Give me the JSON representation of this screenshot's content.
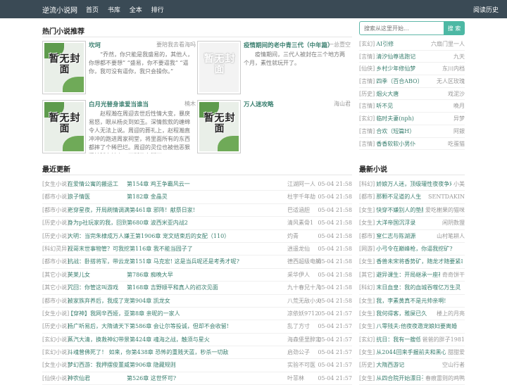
{
  "nav": {
    "brand": "逆流小说网",
    "links": [
      "首页",
      "书库",
      "全本",
      "排行"
    ],
    "history": "阅读历史"
  },
  "search": {
    "placeholder": "搜索从这里开始...",
    "button": "搜 索"
  },
  "hot": {
    "title": "热门小说推荐",
    "cover_text": "暂无封面",
    "items": [
      {
        "title": "坎坷",
        "author": "要陪我去看海吗",
        "desc": "“乔然，你只能是我盛易的，其他人，你想都不要想”  “盛易，你不要逼我” “逼你，我可没有逼你，我只会操你。”",
        "blank": false
      },
      {
        "title": "疫情期间的老中青三代（中年篇）",
        "author": "一总壹空",
        "desc": "疫情期间，三代人被封在三个地方两个月，素性就玩开了。",
        "blank": true
      },
      {
        "title": "白月光替身谁爱当谁当",
        "author": "楠木",
        "desc": "赵程瀚在周迎去世后性情大变，暴戾易怒，眼从杨炎到如玉。深情款款的缠绵令人无法上说。周迎的葬礼上，赵程瀚直冲冲的跑进周家祠堂，将里面所有的东西都摔了个稀巴烂。周迎的灵位也被他恶狠狠地踩在地上，不断的在脚下",
        "blank": false
      },
      {
        "title": "万人迷攻略",
        "author": "海山君",
        "desc": "",
        "blank": false
      }
    ]
  },
  "rank": [
    {
      "cat": "[玄幻]",
      "title": "AI引修",
      "author": "六扇门里一人"
    },
    {
      "cat": "[言情]",
      "title": "清汐仙尊逃跑记",
      "author": "九天"
    },
    {
      "cat": "[仙侠]",
      "title": "乡村少年修仙梦",
      "author": "东川内档"
    },
    {
      "cat": "[言情]",
      "title": "四季（百合ABO）",
      "author": "无人区玫瑰"
    },
    {
      "cat": "[历史]",
      "title": "烟火大唐",
      "author": "戏泥沙"
    },
    {
      "cat": "[言情]",
      "title": "听不见",
      "author": "晚月"
    },
    {
      "cat": "[玄幻]",
      "title": "临时夫妻(nph)",
      "author": "异梦"
    },
    {
      "cat": "[言情]",
      "title": "合欢（短篇H）",
      "author": "阿銀"
    },
    {
      "cat": "[言情]",
      "title": "香香软软小男仆",
      "author": "吃蛋猫"
    }
  ],
  "latest": {
    "title": "最近更新",
    "rows": [
      {
        "cat": "[女生小说]",
        "title": "在爱情公寓的搬运工",
        "chapter": "第154章 鸡王争霸风云一",
        "author": "江湖阿一人",
        "date": "05-04 21:58"
      },
      {
        "cat": "[都市小说]",
        "title": "浪子情医",
        "chapter": "第182章 金晶灵",
        "author": "杜宇千年劫",
        "date": "05-04 21:58"
      },
      {
        "cat": "[都市小说]",
        "title": "老穿星夜，开局刷情调满第461章 邪阵！献祭日家!",
        "chapter": "",
        "author": "巴适涵胆",
        "date": "05-04 21:58"
      },
      {
        "cat": "[历史小说]",
        "title": "身为p社玩家的我，回到",
        "chapter": "第680章 波西米亚内战2",
        "author": "清风素骨1",
        "date": "05-04 21:58"
      },
      {
        "cat": "[历史小说]",
        "title": "大明：当完朱棣成万人嫌王第1906章 宠文结束后的女配（110）",
        "chapter": "",
        "author": "灼青",
        "date": "05-04 21:58"
      },
      {
        "cat": "[科幻灵异]",
        "title": "视哥末世事物管？可我挖第116章 我不能当园子了",
        "chapter": "",
        "author": "逍遥龙仙",
        "date": "05-04 21:58"
      },
      {
        "cat": "[都市小说]",
        "title": "抗战：卧搭将军，带云龙第151章 马克宏! 这是当兵呢还是考秀才呢?",
        "chapter": "",
        "author": "德西超级电鲷",
        "date": "05-04 21:58"
      },
      {
        "cat": "[其它小说]",
        "title": "芙莱儿女",
        "chapter": "第786章 痴晚大早",
        "author": "采华伊人",
        "date": "05-04 21:58"
      },
      {
        "cat": "[其它小说]",
        "title": "咒回：你管这叫游戏",
        "chapter": "第168章 吉野顺平和真人的初次见面",
        "author": "九十春兄十几",
        "date": "05-04 21:58"
      },
      {
        "cat": "[都市小说]",
        "title": "被家族弃养后，我成了宠第904章 凯龙女",
        "chapter": "",
        "author": "八荒无敌小火",
        "date": "05-04 21:58"
      },
      {
        "cat": "[女生小说]",
        "title": "【穿神】我网辛西娅，亚第8章 亲昵的一家人",
        "chapter": "",
        "author": "凉依妖9712",
        "date": "05-04 21:57"
      },
      {
        "cat": "[历史小说]",
        "title": "杨广听易后，大隋请天下第586章 会让尔等投诚，但却不会收留!",
        "chapter": "",
        "author": "乱了方寸",
        "date": "05-04 21:57"
      },
      {
        "cat": "[玄幻小说]",
        "title": "蒸汽大清，换救神幻带景第424章 魂海之战，触须与星火",
        "chapter": "",
        "author": "海森堡里醉定",
        "date": "05-04 21:57"
      },
      {
        "cat": "[玄幻小说]",
        "title": "斗魂曾佛死了！ 如来，你第438章 恐怖的重贱天蓝，秒杀一切敌",
        "chapter": "",
        "author": "启劲公子",
        "date": "05-04 21:57"
      },
      {
        "cat": "[女生小说]",
        "title": "梦幻西游：我押摆俊董威第906章 隐藏规则",
        "chapter": "",
        "author": "实验不可医",
        "date": "05-04 21:57"
      },
      {
        "cat": "[仙侠小说]",
        "title": "神农仙君",
        "chapter": "第526章 这世怀可?",
        "author": "叶菲林",
        "date": "05-04 21:57"
      }
    ]
  },
  "newest": {
    "title": "最新小说",
    "rows": [
      {
        "cat": "[科幻]",
        "title": "娇娘万人迷，顶级瓘性夜夜争欢",
        "author": "小美",
        "date": ""
      },
      {
        "cat": "[都市]",
        "title": "那颗不足道的人生",
        "author": "SENTDAKIN"
      },
      {
        "cat": "[女生]",
        "title": "快穿不嫌别人的垫脚石",
        "author": "爱吃榭果的猫咪"
      },
      {
        "cat": "[女生]",
        "title": "大洋帝国沉浮录",
        "author": "闲阴数狸"
      },
      {
        "cat": "[都市]",
        "title": "窒仁志与陈湖源",
        "author": "山村笔耕人"
      },
      {
        "cat": "[网游]",
        "title": "小弓令在巅峰枪，你逼我挖矿?",
        "author": ""
      },
      {
        "cat": "[女生]",
        "title": "香兽未宋将香势矿，随龙才随要紧事",
        "author": ""
      },
      {
        "cat": "[其它]",
        "title": "避异课生：开局继承一座神庙",
        "author": "奇奇饼干"
      },
      {
        "cat": "[科幻]",
        "title": "末日血皇：我的血城吞噬亿万生灵",
        "author": ""
      },
      {
        "cat": "[女生]",
        "title": "我，李素黄真不是元帅亲啊!",
        "author": ""
      },
      {
        "cat": "[女生]",
        "title": "我何得客，雅屎已久",
        "author": "楼上的月亮"
      },
      {
        "cat": "[女生]",
        "title": "八零残夫:他夜夜邀宠娘妇要离婚",
        "author": ""
      },
      {
        "cat": "[玄幻]",
        "title": "抗日：我有一艘低雷艇",
        "author": "爸爸的胖子1981"
      },
      {
        "cat": "[女生]",
        "title": "从2044回来手握前夫和黑心帽",
        "author": "甜甜爱"
      },
      {
        "cat": "[历史]",
        "title": "大隋西游记",
        "author": "空山行者"
      },
      {
        "cat": "[女生]",
        "title": "从四合院开始漂日子",
        "author": "春痕雷则的鸡鸭"
      }
    ]
  }
}
